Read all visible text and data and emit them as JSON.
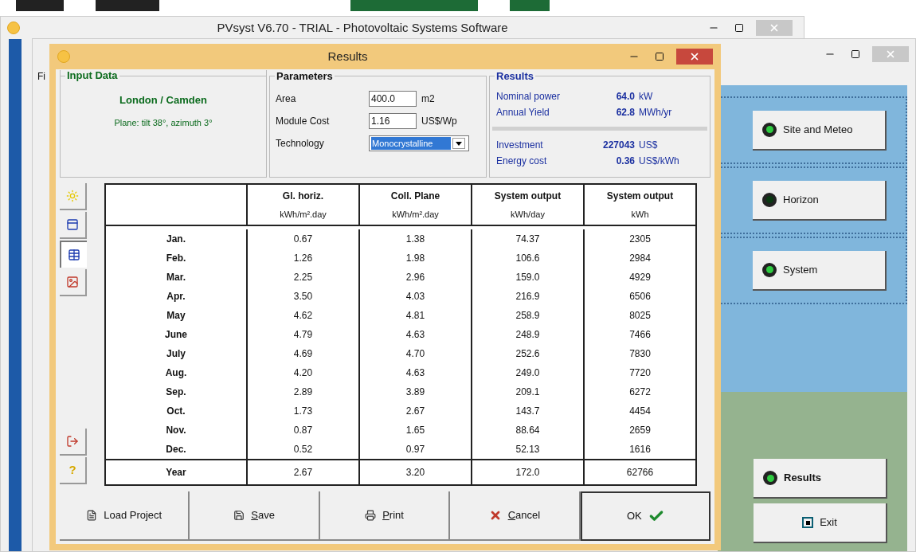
{
  "main_window": {
    "title": "PVsyst V6.70 - TRIAL - Photovoltaic Systems Software"
  },
  "project_window": {
    "menu_fragment": "Fi",
    "buttons": [
      {
        "label": "Site and Meteo",
        "on": true,
        "selected": false
      },
      {
        "label": "Horizon",
        "on": false,
        "selected": false
      },
      {
        "label": "System",
        "on": true,
        "selected": false
      },
      {
        "label": "Results",
        "on": true,
        "selected": true
      }
    ],
    "exit_button": "Exit"
  },
  "dialog": {
    "title": "Results",
    "input_data": {
      "title": "Input Data",
      "site": "London / Camden",
      "plane": "Plane: tilt 38°, azimuth 3°"
    },
    "parameters": {
      "title": "Parameters",
      "fields": [
        {
          "kind": "text",
          "label": "Area",
          "value": "400.0",
          "unit": "m2"
        },
        {
          "kind": "text",
          "label": "Module Cost",
          "value": "1.16",
          "unit": "US$/Wp"
        },
        {
          "kind": "dropdown",
          "label": "Technology",
          "value": "Monocrystalline"
        }
      ]
    },
    "results": {
      "title": "Results",
      "groups": [
        [
          {
            "label": "Nominal power",
            "value": "64.0",
            "unit": "kW"
          },
          {
            "label": "Annual Yield",
            "value": "62.8",
            "unit": "MWh/yr"
          }
        ],
        [
          {
            "label": "Investment",
            "value": "227043",
            "unit": "US$"
          },
          {
            "label": "Energy cost",
            "value": "0.36",
            "unit": "US$/kWh"
          }
        ]
      ]
    },
    "side_tools": [
      {
        "kind": "sun",
        "selected": false
      },
      {
        "kind": "panel",
        "selected": false
      },
      {
        "kind": "table",
        "selected": true
      },
      {
        "kind": "chart",
        "selected": false
      },
      {
        "kind": "export",
        "selected": false
      },
      {
        "kind": "help",
        "selected": false,
        "symbol": "?"
      }
    ],
    "table": {
      "columns": [
        {
          "title": "Gl. horiz.",
          "unit": "kWh/m².day"
        },
        {
          "title": "Coll. Plane",
          "unit": "kWh/m².day"
        },
        {
          "title": "System output",
          "unit": "kWh/day"
        },
        {
          "title": "System output",
          "unit": "kWh"
        }
      ],
      "rows": [
        {
          "month": "Jan.",
          "values": [
            "0.67",
            "1.38",
            "74.37",
            "2305"
          ]
        },
        {
          "month": "Feb.",
          "values": [
            "1.26",
            "1.98",
            "106.6",
            "2984"
          ]
        },
        {
          "month": "Mar.",
          "values": [
            "2.25",
            "2.96",
            "159.0",
            "4929"
          ]
        },
        {
          "month": "Apr.",
          "values": [
            "3.50",
            "4.03",
            "216.9",
            "6506"
          ]
        },
        {
          "month": "May",
          "values": [
            "4.62",
            "4.81",
            "258.9",
            "8025"
          ]
        },
        {
          "month": "June",
          "values": [
            "4.79",
            "4.63",
            "248.9",
            "7466"
          ]
        },
        {
          "month": "July",
          "values": [
            "4.69",
            "4.70",
            "252.6",
            "7830"
          ]
        },
        {
          "month": "Aug.",
          "values": [
            "4.20",
            "4.63",
            "249.0",
            "7720"
          ]
        },
        {
          "month": "Sep.",
          "values": [
            "2.89",
            "3.89",
            "209.1",
            "6272"
          ]
        },
        {
          "month": "Oct.",
          "values": [
            "1.73",
            "2.67",
            "143.7",
            "4454"
          ]
        },
        {
          "month": "Nov.",
          "values": [
            "0.87",
            "1.65",
            "88.64",
            "2659"
          ]
        },
        {
          "month": "Dec.",
          "values": [
            "0.52",
            "0.97",
            "52.13",
            "1616"
          ]
        }
      ],
      "total": {
        "label": "Year",
        "values": [
          "2.67",
          "3.20",
          "172.0",
          "62766"
        ]
      }
    },
    "buttons": [
      {
        "kind": "load",
        "label": "Load Project",
        "underline_first": false,
        "default": false
      },
      {
        "kind": "save",
        "label": "Save",
        "underline_first": true,
        "default": false
      },
      {
        "kind": "print",
        "label": "Print",
        "underline_first": true,
        "default": false
      },
      {
        "kind": "cancel",
        "label": "Cancel",
        "underline_first": true,
        "default": false
      },
      {
        "kind": "ok",
        "label": "OK",
        "underline_first": false,
        "default": true
      }
    ]
  }
}
